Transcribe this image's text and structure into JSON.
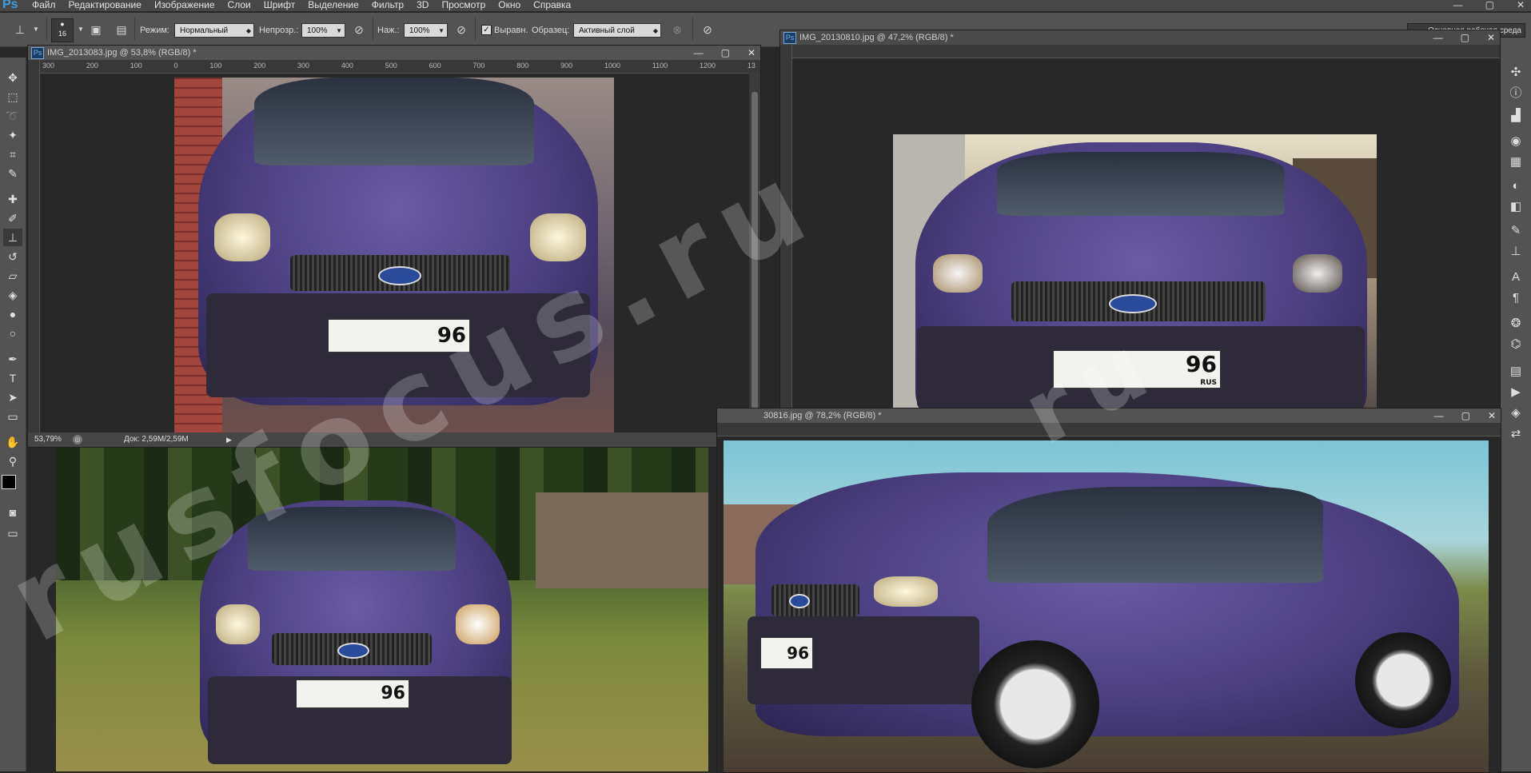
{
  "app": {
    "logo": "Ps"
  },
  "menu": [
    "Файл",
    "Редактирование",
    "Изображение",
    "Слои",
    "Шрифт",
    "Выделение",
    "Фильтр",
    "3D",
    "Просмотр",
    "Окно",
    "Справка"
  ],
  "options": {
    "brush_size": "16",
    "mode_label": "Режим:",
    "mode_value": "Нормальный",
    "opacity_label": "Непрозр.:",
    "opacity_value": "100%",
    "pressure_label": "Наж.:",
    "pressure_value": "100%",
    "aligned_label": "Выравн.",
    "sample_label": "Образец:",
    "sample_value": "Активный слой",
    "workspace_value": "Основная рабочая среда"
  },
  "documents": [
    {
      "title": "IMG_2013083.jpg @ 53,8% (RGB/8) *",
      "ruler": [
        "300",
        "200",
        "100",
        "0",
        "100",
        "200",
        "300",
        "400",
        "500",
        "600",
        "700",
        "800",
        "900",
        "1000",
        "1100",
        "1200",
        "13"
      ],
      "zoom": "53,79%",
      "doc_info": "Док: 2,59M/2,59M",
      "plate": "96"
    },
    {
      "title": "IMG_20130810.jpg @ 47,2% (RGB/8) *",
      "plate": "96",
      "plate_region": "RUS"
    },
    {
      "title": "30816.jpg @ 78,2% (RGB/8) *",
      "plate": "96"
    }
  ],
  "bottom_left_photo": {
    "plate": "96"
  },
  "watermark": "rusfocus.ru",
  "icons": {
    "tools": [
      "move-icon",
      "marquee-icon",
      "lasso-icon",
      "magic-wand-icon",
      "crop-icon",
      "eyedropper-icon",
      "healing-icon",
      "brush-icon",
      "clone-stamp-icon",
      "history-brush-icon",
      "eraser-icon",
      "paint-bucket-icon",
      "blur-icon",
      "dodge-icon",
      "pen-icon",
      "type-icon",
      "path-select-icon",
      "shape-icon",
      "hand-icon",
      "zoom-icon"
    ],
    "panels": [
      "navigator-icon",
      "info-icon",
      "histogram-icon",
      "color-icon",
      "swatches-icon",
      "styles-icon",
      "adjustments-icon",
      "brush-presets-icon",
      "character-icon",
      "paragraph-icon",
      "layers-icon",
      "channels-icon",
      "paths-icon",
      "actions-icon",
      "history-icon"
    ]
  },
  "colors": {
    "accent": "#3c9de0",
    "ui_bg": "#535353",
    "canvas_bg": "#282828"
  }
}
